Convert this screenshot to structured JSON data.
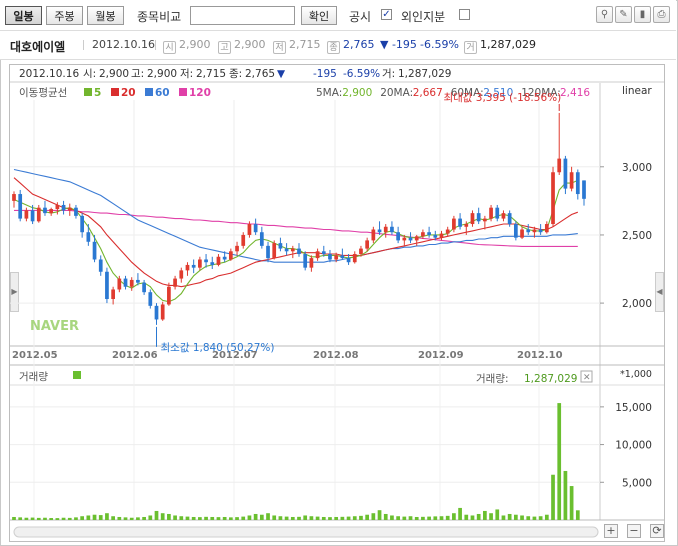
{
  "toolbar": {
    "tabs": [
      {
        "label": "일봉",
        "selected": true
      },
      {
        "label": "주봉",
        "selected": false
      },
      {
        "label": "월봉",
        "selected": false
      }
    ],
    "compare_label": "종목비교",
    "compare_input_value": "",
    "confirm_label": "확인",
    "disclosure_label": "공시",
    "disclosure_checked": true,
    "foreign_label": "외인지분",
    "foreign_checked": false
  },
  "info": {
    "name": "대호에이엘",
    "date": "2012.10.16",
    "open_badge": "시",
    "open": "2,900",
    "high_badge": "고",
    "high": "2,900",
    "low_badge": "저",
    "low": "2,715",
    "close_badge": "종",
    "close": "2,765",
    "change": "▼ -195",
    "change_pct": "-6.59%",
    "volume_badge": "거",
    "volume": "1,287,029"
  },
  "chart_header": {
    "date": "2012.10.16",
    "o_label": "시:",
    "o": "2,900",
    "h_label": "고:",
    "h": "2,900",
    "l_label": "저:",
    "l": "2,715",
    "c_label": "종:",
    "c": "2,765",
    "c_arrow": "▼",
    "chg": "-195",
    "chg_pct": "-6.59%",
    "v_label": "거:",
    "v": "1,287,029"
  },
  "colors": {
    "up": "#e03b2f",
    "down": "#2a78d2",
    "ma5": "#72b52d",
    "ma20": "#d92e2e",
    "ma60": "#3b7bd4",
    "ma120": "#e040a8",
    "volume": "#6abf2f"
  },
  "chart_data": {
    "type": "candlestick",
    "legend": {
      "title": "이동평균선",
      "items": [
        {
          "name": "5",
          "color": "#72b52d"
        },
        {
          "name": "20",
          "color": "#d92e2e"
        },
        {
          "name": "60",
          "color": "#3b7bd4"
        },
        {
          "name": "120",
          "color": "#e040a8"
        }
      ]
    },
    "ma_readout": [
      {
        "label": "5MA:",
        "value": "2,900",
        "color": "#72b52d"
      },
      {
        "label": "20MA:",
        "value": "2,667",
        "color": "#d92e2e"
      },
      {
        "label": "60MA:",
        "value": "2,510",
        "color": "#3b7bd4"
      },
      {
        "label": "120MA:",
        "value": "2,416",
        "color": "#e040a8"
      }
    ],
    "scale_label": "linear",
    "x_ticks": [
      "2012.05",
      "2012.06",
      "2012.07",
      "2012.08",
      "2012.09",
      "2012.10"
    ],
    "y_ticks": [
      "3,000",
      "2,500",
      "2,000"
    ],
    "y_tick_values": [
      3000,
      2500,
      2000
    ],
    "ylim": [
      1700,
      3600
    ],
    "max_annotation": "최대값 3,395 (-18.56%)",
    "min_annotation": "최소값 1,840 (50.27%)",
    "watermark": "NAVER",
    "candles": [
      {
        "o": 2750,
        "h": 2820,
        "l": 2700,
        "c": 2800
      },
      {
        "o": 2800,
        "h": 2830,
        "l": 2600,
        "c": 2620
      },
      {
        "o": 2620,
        "h": 2700,
        "l": 2600,
        "c": 2680
      },
      {
        "o": 2680,
        "h": 2720,
        "l": 2580,
        "c": 2600
      },
      {
        "o": 2600,
        "h": 2720,
        "l": 2590,
        "c": 2700
      },
      {
        "o": 2700,
        "h": 2750,
        "l": 2640,
        "c": 2660
      },
      {
        "o": 2660,
        "h": 2700,
        "l": 2640,
        "c": 2690
      },
      {
        "o": 2690,
        "h": 2740,
        "l": 2650,
        "c": 2720
      },
      {
        "o": 2720,
        "h": 2750,
        "l": 2650,
        "c": 2680
      },
      {
        "o": 2680,
        "h": 2730,
        "l": 2640,
        "c": 2700
      },
      {
        "o": 2700,
        "h": 2720,
        "l": 2620,
        "c": 2640
      },
      {
        "o": 2640,
        "h": 2660,
        "l": 2480,
        "c": 2520
      },
      {
        "o": 2520,
        "h": 2580,
        "l": 2420,
        "c": 2450
      },
      {
        "o": 2450,
        "h": 2500,
        "l": 2300,
        "c": 2320
      },
      {
        "o": 2320,
        "h": 2350,
        "l": 2200,
        "c": 2230
      },
      {
        "o": 2230,
        "h": 2260,
        "l": 2000,
        "c": 2030
      },
      {
        "o": 2030,
        "h": 2120,
        "l": 1990,
        "c": 2100
      },
      {
        "o": 2100,
        "h": 2200,
        "l": 2080,
        "c": 2180
      },
      {
        "o": 2180,
        "h": 2200,
        "l": 2100,
        "c": 2120
      },
      {
        "o": 2120,
        "h": 2190,
        "l": 2090,
        "c": 2170
      },
      {
        "o": 2170,
        "h": 2220,
        "l": 2130,
        "c": 2150
      },
      {
        "o": 2150,
        "h": 2170,
        "l": 2060,
        "c": 2080
      },
      {
        "o": 2080,
        "h": 2100,
        "l": 1960,
        "c": 1980
      },
      {
        "o": 1980,
        "h": 2000,
        "l": 1840,
        "c": 1880
      },
      {
        "o": 1880,
        "h": 2010,
        "l": 1870,
        "c": 1990
      },
      {
        "o": 1990,
        "h": 2150,
        "l": 1980,
        "c": 2120
      },
      {
        "o": 2120,
        "h": 2200,
        "l": 2100,
        "c": 2180
      },
      {
        "o": 2180,
        "h": 2260,
        "l": 2150,
        "c": 2240
      },
      {
        "o": 2240,
        "h": 2300,
        "l": 2200,
        "c": 2280
      },
      {
        "o": 2280,
        "h": 2320,
        "l": 2220,
        "c": 2260
      },
      {
        "o": 2260,
        "h": 2340,
        "l": 2240,
        "c": 2320
      },
      {
        "o": 2320,
        "h": 2360,
        "l": 2260,
        "c": 2300
      },
      {
        "o": 2300,
        "h": 2340,
        "l": 2250,
        "c": 2280
      },
      {
        "o": 2280,
        "h": 2360,
        "l": 2270,
        "c": 2340
      },
      {
        "o": 2340,
        "h": 2380,
        "l": 2300,
        "c": 2320
      },
      {
        "o": 2320,
        "h": 2400,
        "l": 2310,
        "c": 2380
      },
      {
        "o": 2380,
        "h": 2450,
        "l": 2350,
        "c": 2420
      },
      {
        "o": 2420,
        "h": 2520,
        "l": 2400,
        "c": 2500
      },
      {
        "o": 2500,
        "h": 2600,
        "l": 2480,
        "c": 2580
      },
      {
        "o": 2580,
        "h": 2620,
        "l": 2500,
        "c": 2520
      },
      {
        "o": 2520,
        "h": 2560,
        "l": 2400,
        "c": 2420
      },
      {
        "o": 2420,
        "h": 2450,
        "l": 2300,
        "c": 2330
      },
      {
        "o": 2330,
        "h": 2460,
        "l": 2320,
        "c": 2440
      },
      {
        "o": 2440,
        "h": 2480,
        "l": 2380,
        "c": 2400
      },
      {
        "o": 2400,
        "h": 2440,
        "l": 2350,
        "c": 2380
      },
      {
        "o": 2380,
        "h": 2420,
        "l": 2330,
        "c": 2400
      },
      {
        "o": 2400,
        "h": 2440,
        "l": 2340,
        "c": 2360
      },
      {
        "o": 2360,
        "h": 2380,
        "l": 2240,
        "c": 2260
      },
      {
        "o": 2260,
        "h": 2350,
        "l": 2230,
        "c": 2330
      },
      {
        "o": 2330,
        "h": 2400,
        "l": 2310,
        "c": 2380
      },
      {
        "o": 2380,
        "h": 2420,
        "l": 2340,
        "c": 2360
      },
      {
        "o": 2360,
        "h": 2390,
        "l": 2300,
        "c": 2320
      },
      {
        "o": 2320,
        "h": 2370,
        "l": 2300,
        "c": 2350
      },
      {
        "o": 2350,
        "h": 2400,
        "l": 2320,
        "c": 2330
      },
      {
        "o": 2330,
        "h": 2360,
        "l": 2280,
        "c": 2300
      },
      {
        "o": 2300,
        "h": 2380,
        "l": 2290,
        "c": 2360
      },
      {
        "o": 2360,
        "h": 2420,
        "l": 2340,
        "c": 2400
      },
      {
        "o": 2400,
        "h": 2480,
        "l": 2380,
        "c": 2460
      },
      {
        "o": 2460,
        "h": 2560,
        "l": 2440,
        "c": 2540
      },
      {
        "o": 2540,
        "h": 2600,
        "l": 2500,
        "c": 2520
      },
      {
        "o": 2520,
        "h": 2580,
        "l": 2480,
        "c": 2560
      },
      {
        "o": 2560,
        "h": 2600,
        "l": 2500,
        "c": 2520
      },
      {
        "o": 2520,
        "h": 2560,
        "l": 2440,
        "c": 2460
      },
      {
        "o": 2460,
        "h": 2500,
        "l": 2420,
        "c": 2480
      },
      {
        "o": 2480,
        "h": 2520,
        "l": 2440,
        "c": 2460
      },
      {
        "o": 2460,
        "h": 2500,
        "l": 2420,
        "c": 2490
      },
      {
        "o": 2490,
        "h": 2540,
        "l": 2470,
        "c": 2520
      },
      {
        "o": 2520,
        "h": 2560,
        "l": 2480,
        "c": 2500
      },
      {
        "o": 2500,
        "h": 2530,
        "l": 2460,
        "c": 2480
      },
      {
        "o": 2480,
        "h": 2530,
        "l": 2460,
        "c": 2510
      },
      {
        "o": 2510,
        "h": 2560,
        "l": 2490,
        "c": 2540
      },
      {
        "o": 2540,
        "h": 2640,
        "l": 2520,
        "c": 2620
      },
      {
        "o": 2620,
        "h": 2660,
        "l": 2540,
        "c": 2560
      },
      {
        "o": 2560,
        "h": 2600,
        "l": 2500,
        "c": 2580
      },
      {
        "o": 2580,
        "h": 2680,
        "l": 2560,
        "c": 2660
      },
      {
        "o": 2660,
        "h": 2700,
        "l": 2580,
        "c": 2600
      },
      {
        "o": 2600,
        "h": 2640,
        "l": 2540,
        "c": 2620
      },
      {
        "o": 2620,
        "h": 2720,
        "l": 2600,
        "c": 2700
      },
      {
        "o": 2700,
        "h": 2720,
        "l": 2600,
        "c": 2620
      },
      {
        "o": 2620,
        "h": 2680,
        "l": 2600,
        "c": 2660
      },
      {
        "o": 2660,
        "h": 2680,
        "l": 2560,
        "c": 2580
      },
      {
        "o": 2580,
        "h": 2600,
        "l": 2460,
        "c": 2480
      },
      {
        "o": 2480,
        "h": 2560,
        "l": 2470,
        "c": 2540
      },
      {
        "o": 2540,
        "h": 2580,
        "l": 2500,
        "c": 2520
      },
      {
        "o": 2520,
        "h": 2560,
        "l": 2480,
        "c": 2540
      },
      {
        "o": 2540,
        "h": 2580,
        "l": 2500,
        "c": 2520
      },
      {
        "o": 2520,
        "h": 2600,
        "l": 2510,
        "c": 2580
      },
      {
        "o": 2580,
        "h": 3000,
        "l": 2560,
        "c": 2960
      },
      {
        "o": 2960,
        "h": 3395,
        "l": 2940,
        "c": 3060
      },
      {
        "o": 3060,
        "h": 3080,
        "l": 2800,
        "c": 2840
      },
      {
        "o": 2840,
        "h": 3000,
        "l": 2820,
        "c": 2960
      },
      {
        "o": 2960,
        "h": 2980,
        "l": 2760,
        "c": 2800
      },
      {
        "o": 2900,
        "h": 2900,
        "l": 2715,
        "c": 2765
      }
    ],
    "ma5": [
      2760,
      2740,
      2720,
      2700,
      2690,
      2670,
      2660,
      2670,
      2690,
      2700,
      2680,
      2620,
      2560,
      2480,
      2400,
      2300,
      2220,
      2170,
      2130,
      2110,
      2140,
      2150,
      2120,
      2060,
      2020,
      2010,
      2030,
      2070,
      2140,
      2200,
      2240,
      2270,
      2280,
      2290,
      2300,
      2320,
      2340,
      2370,
      2420,
      2460,
      2470,
      2460,
      2440,
      2420,
      2400,
      2400,
      2390,
      2360,
      2340,
      2340,
      2350,
      2350,
      2350,
      2340,
      2330,
      2340,
      2350,
      2380,
      2430,
      2480,
      2520,
      2530,
      2510,
      2490,
      2480,
      2480,
      2490,
      2500,
      2500,
      2500,
      2510,
      2550,
      2570,
      2580,
      2600,
      2620,
      2610,
      2620,
      2640,
      2650,
      2640,
      2600,
      2560,
      2540,
      2530,
      2530,
      2540,
      2680,
      2830,
      2880,
      2880,
      2900
    ],
    "ma20": [
      2920,
      2880,
      2840,
      2800,
      2780,
      2760,
      2740,
      2720,
      2700,
      2690,
      2680,
      2660,
      2640,
      2600,
      2560,
      2500,
      2450,
      2400,
      2350,
      2300,
      2260,
      2220,
      2190,
      2160,
      2140,
      2130,
      2130,
      2120,
      2130,
      2140,
      2150,
      2170,
      2180,
      2200,
      2210,
      2220,
      2240,
      2260,
      2280,
      2300,
      2310,
      2320,
      2330,
      2340,
      2350,
      2360,
      2370,
      2370,
      2370,
      2370,
      2360,
      2360,
      2360,
      2350,
      2350,
      2350,
      2350,
      2360,
      2370,
      2380,
      2390,
      2400,
      2410,
      2420,
      2430,
      2440,
      2450,
      2460,
      2470,
      2480,
      2490,
      2500,
      2510,
      2520,
      2530,
      2540,
      2550,
      2560,
      2570,
      2580,
      2580,
      2580,
      2570,
      2560,
      2550,
      2540,
      2540,
      2560,
      2590,
      2620,
      2650,
      2667
    ],
    "ma60": [
      2980,
      2970,
      2960,
      2950,
      2940,
      2930,
      2920,
      2910,
      2900,
      2890,
      2870,
      2850,
      2830,
      2810,
      2790,
      2760,
      2730,
      2700,
      2670,
      2640,
      2610,
      2590,
      2570,
      2550,
      2530,
      2510,
      2490,
      2470,
      2450,
      2430,
      2410,
      2400,
      2390,
      2380,
      2370,
      2360,
      2350,
      2340,
      2330,
      2320,
      2310,
      2310,
      2300,
      2300,
      2300,
      2300,
      2300,
      2300,
      2300,
      2300,
      2300,
      2310,
      2310,
      2320,
      2330,
      2340,
      2350,
      2360,
      2370,
      2380,
      2390,
      2400,
      2400,
      2410,
      2410,
      2420,
      2420,
      2430,
      2430,
      2440,
      2440,
      2450,
      2450,
      2460,
      2460,
      2470,
      2470,
      2480,
      2480,
      2490,
      2490,
      2490,
      2490,
      2490,
      2490,
      2490,
      2490,
      2500,
      2500,
      2500,
      2505,
      2510
    ],
    "ma120": [
      2680,
      2680,
      2680,
      2680,
      2680,
      2680,
      2680,
      2680,
      2680,
      2680,
      2675,
      2670,
      2670,
      2665,
      2660,
      2660,
      2655,
      2650,
      2650,
      2645,
      2640,
      2640,
      2635,
      2630,
      2630,
      2625,
      2620,
      2620,
      2615,
      2610,
      2610,
      2605,
      2600,
      2600,
      2595,
      2590,
      2590,
      2585,
      2580,
      2580,
      2575,
      2570,
      2570,
      2565,
      2560,
      2560,
      2555,
      2550,
      2550,
      2545,
      2540,
      2540,
      2535,
      2530,
      2530,
      2525,
      2520,
      2520,
      2515,
      2510,
      2505,
      2500,
      2495,
      2490,
      2485,
      2480,
      2475,
      2470,
      2465,
      2460,
      2455,
      2450,
      2445,
      2440,
      2435,
      2430,
      2428,
      2426,
      2424,
      2422,
      2420,
      2418,
      2416,
      2416,
      2416,
      2416,
      2416,
      2416,
      2416,
      2416,
      2416,
      2416
    ],
    "volume_panel": {
      "title": "거래량",
      "readout_label": "거래량:",
      "readout_value": "1,287,029",
      "unit": "*1,000",
      "y_ticks": [
        "15,000",
        "10,000",
        "5,000"
      ],
      "y_tick_values": [
        15000,
        10000,
        5000
      ],
      "ylim": [
        0,
        17500
      ],
      "values": [
        400,
        350,
        300,
        320,
        280,
        300,
        260,
        250,
        300,
        280,
        350,
        500,
        600,
        700,
        650,
        900,
        500,
        400,
        350,
        300,
        350,
        400,
        600,
        1200,
        900,
        800,
        600,
        500,
        450,
        400,
        380,
        420,
        400,
        380,
        400,
        350,
        380,
        450,
        600,
        800,
        700,
        900,
        600,
        500,
        450,
        400,
        420,
        600,
        500,
        450,
        400,
        380,
        400,
        420,
        450,
        500,
        550,
        700,
        900,
        1300,
        800,
        600,
        500,
        450,
        500,
        400,
        420,
        450,
        480,
        500,
        550,
        900,
        1600,
        700,
        600,
        800,
        1200,
        900,
        1400,
        600,
        800,
        700,
        600,
        500,
        450,
        500,
        700,
        6000,
        15500,
        6500,
        4500,
        1287
      ]
    }
  }
}
